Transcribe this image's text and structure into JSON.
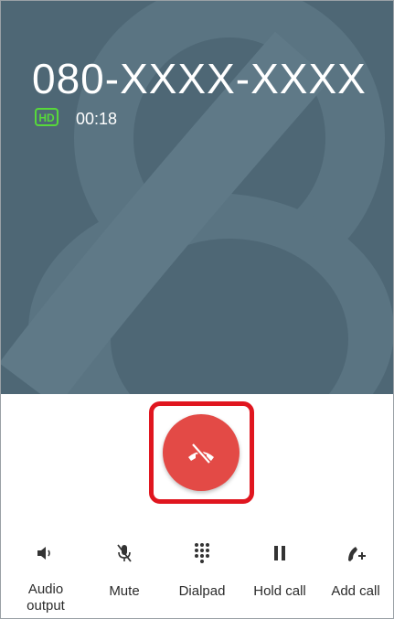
{
  "call": {
    "number": "080-XXXX-XXXX",
    "hd_badge": "HD",
    "duration": "00:18"
  },
  "end_call": {
    "icon": "end-call-icon"
  },
  "colors": {
    "background": "#4e6775",
    "end_button": "#e34a46",
    "highlight": "#e0161f",
    "hd_badge": "#57d93a"
  },
  "actions": [
    {
      "label": "Audio\noutput",
      "icon": "speaker-icon"
    },
    {
      "label": "Mute",
      "icon": "mic-off-icon"
    },
    {
      "label": "Dialpad",
      "icon": "dialpad-icon"
    },
    {
      "label": "Hold call",
      "icon": "pause-icon"
    },
    {
      "label": "Add call",
      "icon": "add-call-icon"
    }
  ]
}
